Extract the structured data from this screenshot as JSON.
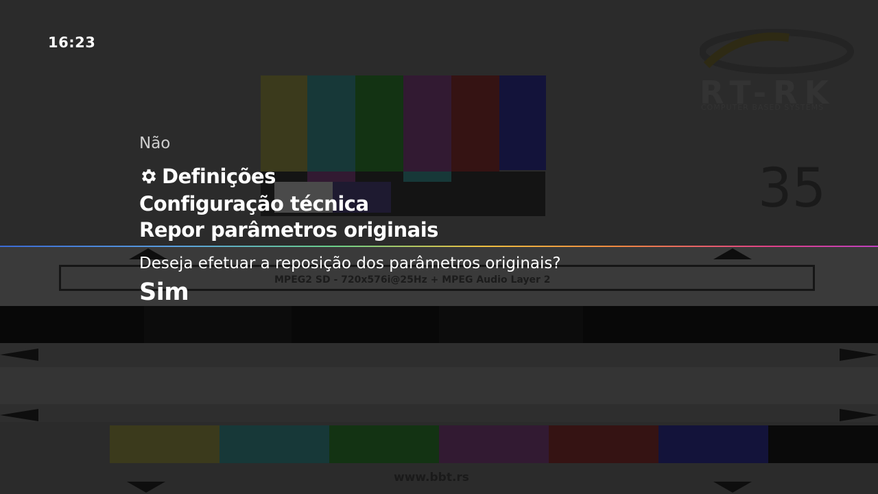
{
  "status": {
    "clock": "16:23"
  },
  "dialog": {
    "option_no": "Não",
    "breadcrumb": [
      {
        "label": "Definições",
        "icon": "gear-icon"
      },
      {
        "label": "Configuração técnica"
      },
      {
        "label": "Repor parâmetros originais"
      }
    ],
    "question": "Deseja efetuar a reposição dos parâmetros originais?",
    "option_yes": "Sim"
  },
  "background": {
    "logo_text": "RT-RK",
    "logo_subtitle": "COMPUTER BASED SYSTEMS",
    "channel_number": "35",
    "stream_info": "MPEG2 SD - 720x576i@25Hz + MPEG Audio Layer 2",
    "url": "www.bbt.rs"
  },
  "colors": {
    "background": "#2b2b2b",
    "text": "#ffffff",
    "dim_text": "#cfcfcf"
  }
}
